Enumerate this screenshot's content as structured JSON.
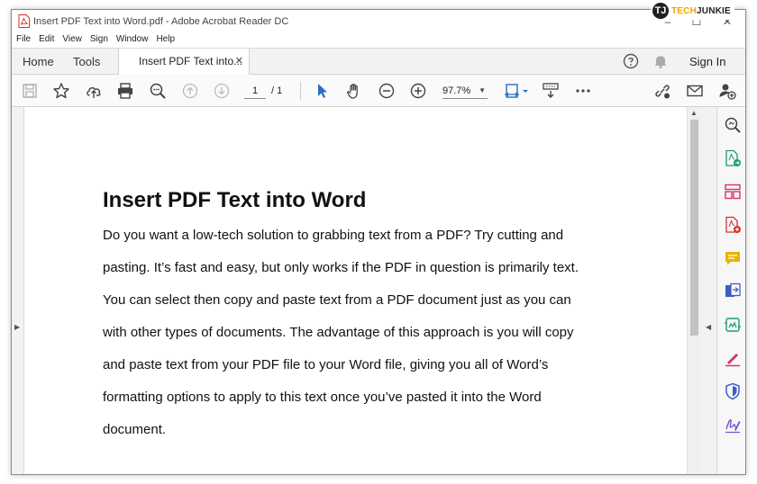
{
  "window": {
    "title": "Insert PDF Text into Word.pdf - Adobe Acrobat Reader DC",
    "minimize": "–",
    "maximize": "☐",
    "close": "✕"
  },
  "watermark": {
    "logo_letter": "TJ",
    "brand_part1": "TECH",
    "brand_part2": "JUNKIE"
  },
  "menu": [
    "File",
    "Edit",
    "View",
    "Sign",
    "Window",
    "Help"
  ],
  "tabs": {
    "home": "Home",
    "tools": "Tools",
    "document": "Insert PDF Text into...",
    "close": "✕",
    "sign_in": "Sign In"
  },
  "toolbar": {
    "page_current": "1",
    "page_total": "/ 1",
    "zoom": "97.7%",
    "zoom_caret": "▼"
  },
  "document": {
    "title": "Insert PDF Text into Word",
    "lines": [
      "Do you want a low-tech solution to grabbing text from a PDF? Try cutting and",
      "pasting. It’s fast and easy, but only works if the PDF in question is primarily text.",
      "You can select then copy and paste text from a PDF document just as you can",
      "with other types of documents. The advantage of this approach is you will copy",
      "and paste text from your PDF file to your Word file, giving you all of Word’s",
      "formatting options to apply to this text once you’ve pasted it into the Word",
      "document."
    ]
  },
  "scroll": {
    "up_arrow": "▲",
    "left_toggle": "▶",
    "right_toggle": "◀"
  },
  "colors": {
    "accent_blue": "#2a6ebb",
    "pdf_red": "#d6322d",
    "export_green": "#1a9e6a",
    "organize_pink": "#d6336c",
    "comment_yellow": "#e8b400",
    "protect_blue": "#3a5fc8",
    "sign_purple": "#7a4fcf"
  }
}
